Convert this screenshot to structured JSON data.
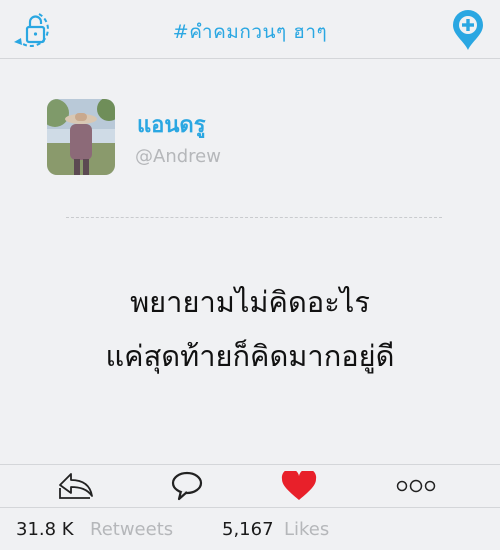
{
  "header": {
    "title": "#คำคมกวนๆ ฮาๆ",
    "lock_icon": "lock-icon",
    "add_icon": "add-pin-icon",
    "accent": "#2aa7e2"
  },
  "profile": {
    "name": "แอนดรู",
    "handle": "@Andrew",
    "avatar_icon": "user-photo"
  },
  "post": {
    "line1": "พยายามไม่คิดอะไร",
    "line2": "แค่สุดท้ายก็คิดมากอยู่ดี"
  },
  "actions": {
    "share_icon": "share-icon",
    "comment_icon": "comment-icon",
    "like_icon": "heart-icon",
    "like_color": "#e8202a",
    "more_icon": "more-icon"
  },
  "stats": {
    "retweets_count": "31.8  K",
    "retweets_label": "Retweets",
    "likes_count": "5,167",
    "likes_label": "Likes"
  }
}
